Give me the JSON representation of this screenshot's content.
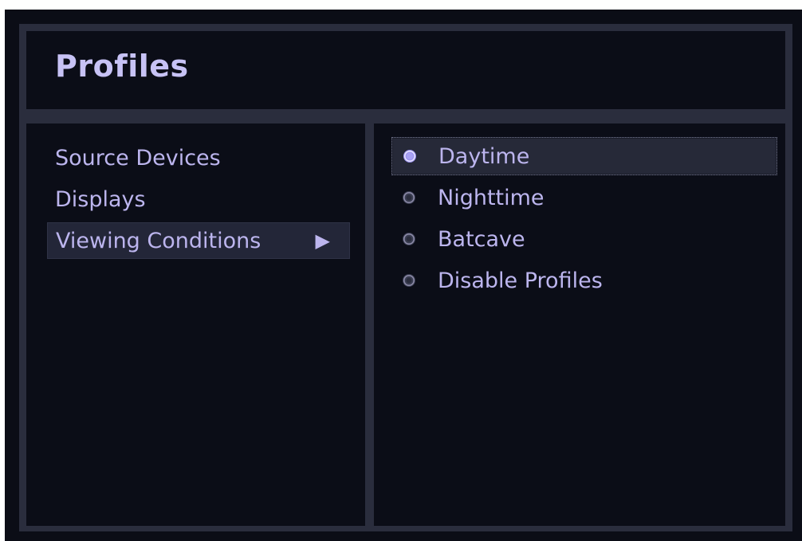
{
  "header": {
    "title": "Profiles"
  },
  "sidebar": {
    "items": [
      {
        "label": "Source Devices",
        "active": false
      },
      {
        "label": "Displays",
        "active": false
      },
      {
        "label": "Viewing Conditions",
        "active": true,
        "submenu_icon": "triangle-right-icon",
        "submenu_glyph": "▶"
      }
    ]
  },
  "options": {
    "items": [
      {
        "label": "Daytime",
        "selected": true,
        "icon": "radio-selected-icon"
      },
      {
        "label": "Nighttime",
        "selected": false,
        "icon": "radio-unselected-icon"
      },
      {
        "label": "Batcave",
        "selected": false,
        "icon": "radio-unselected-icon"
      },
      {
        "label": "Disable Profiles",
        "selected": false,
        "icon": "radio-unselected-icon"
      }
    ]
  },
  "colors": {
    "frame_bg": "#0b0d16",
    "panel_bg": "#0b0d17",
    "border": "#2a2d3d",
    "accent_text": "#bcb5ee",
    "title_text": "#c7c2f5",
    "radio_fill": "#9b93f0"
  }
}
